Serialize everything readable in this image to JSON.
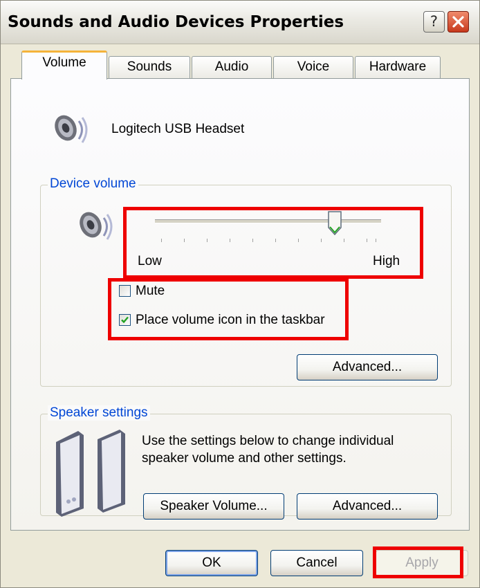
{
  "window": {
    "title": "Sounds and Audio Devices Properties"
  },
  "title_buttons": {
    "help": "?"
  },
  "tabs": [
    "Volume",
    "Sounds",
    "Audio",
    "Voice",
    "Hardware"
  ],
  "device": {
    "name": "Logitech USB Headset"
  },
  "device_volume": {
    "group_label": "Device volume",
    "slider_low_label": "Low",
    "slider_high_label": "High",
    "slider_level": 0.8,
    "mute_label": "Mute",
    "mute_checked": false,
    "taskbar_icon_label": "Place volume icon in the taskbar",
    "taskbar_icon_checked": true,
    "advanced_label": "Advanced..."
  },
  "speaker_settings": {
    "group_label": "Speaker settings",
    "description_line1": "Use the settings below to change individual",
    "description_line2": "speaker volume and other settings.",
    "speaker_volume_label": "Speaker Volume...",
    "advanced_label": "Advanced..."
  },
  "dialog_buttons": {
    "ok": "OK",
    "cancel": "Cancel",
    "apply": "Apply"
  },
  "colors": {
    "highlight": "#ee0000",
    "group_label": "#0046d5",
    "active_tab_accent": "#f5b33a",
    "checkmark": "#21a121"
  },
  "icons": [
    "help-icon",
    "close-icon",
    "speaker-icon",
    "volume-speaker-icon",
    "desktop-speakers-icon",
    "checkmark-icon",
    "slider-thumb-icon"
  ]
}
